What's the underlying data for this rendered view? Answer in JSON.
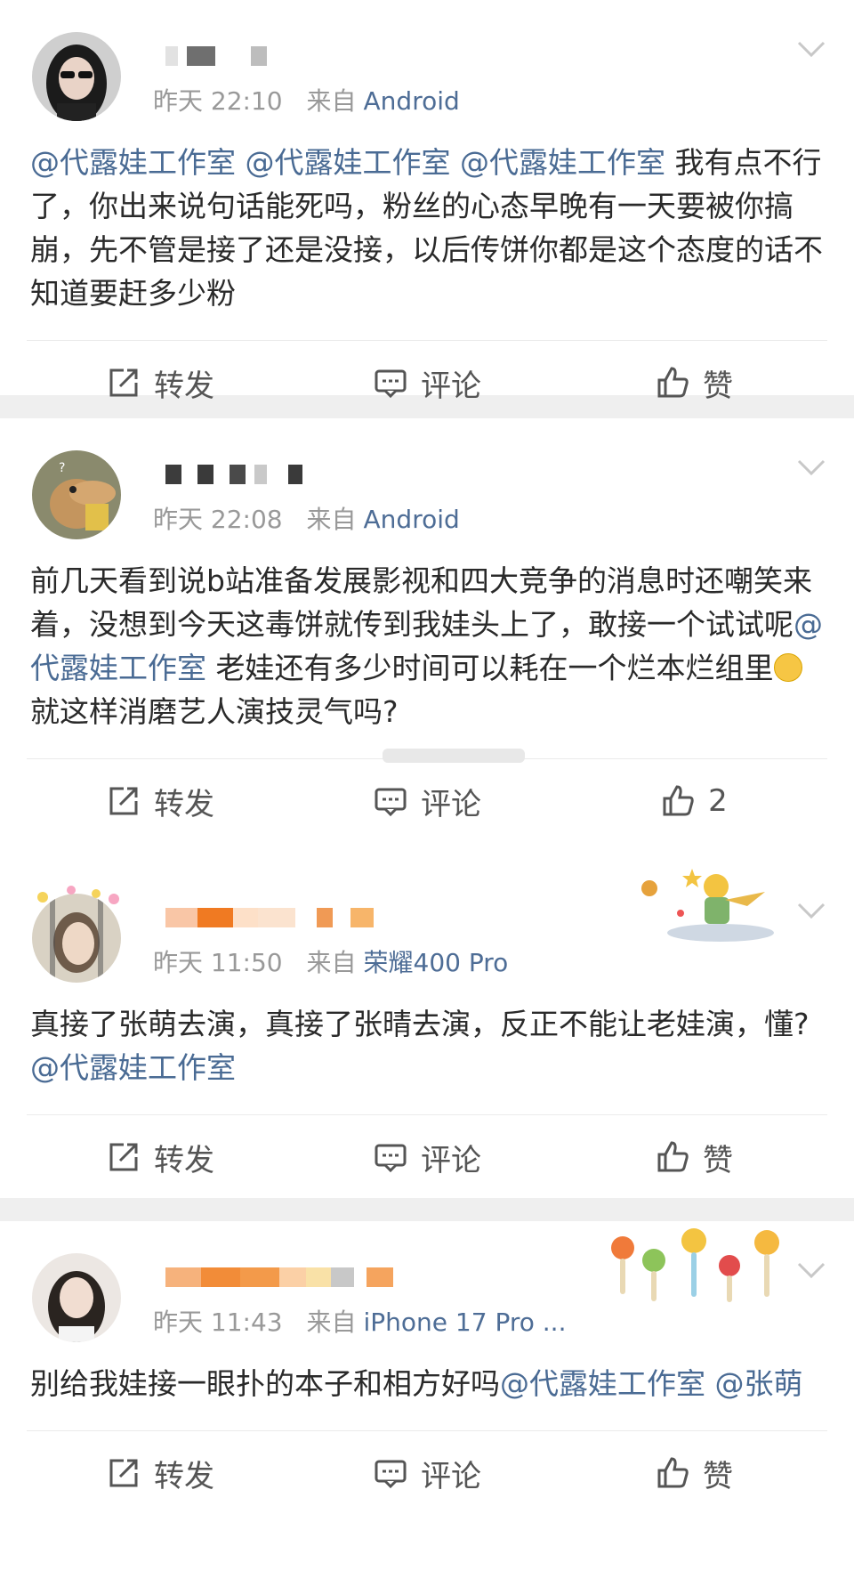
{
  "posts": [
    {
      "time": "昨天 22:10",
      "from": "来自",
      "source": "Android",
      "content": [
        {
          "t": "mention",
          "v": "@代露娃工作室"
        },
        {
          "t": "text",
          "v": " "
        },
        {
          "t": "mention",
          "v": "@代露娃工作室"
        },
        {
          "t": "text",
          "v": " "
        },
        {
          "t": "mention",
          "v": "@代露娃工作室"
        },
        {
          "t": "text",
          "v": " 我有点不行了，你出来说句话能死吗，粉丝的心态早晚有一天要被你搞崩，先不管是接了还是没接，以后传饼你都是这个态度的话不知道要赶多少粉"
        }
      ],
      "actions": {
        "repost": "转发",
        "comment": "评论",
        "like": "赞"
      }
    },
    {
      "time": "昨天 22:08",
      "from": "来自",
      "source": "Android",
      "content": [
        {
          "t": "text",
          "v": "前几天看到说b站准备发展影视和四大竞争的消息时还嘲笑来着，没想到今天这毒饼就传到我娃头上了，敢接一个试试呢"
        },
        {
          "t": "mention",
          "v": "@代露娃工作室"
        },
        {
          "t": "text",
          "v": " 老娃还有多少时间可以耗在一个烂本烂组里"
        },
        {
          "t": "emoji",
          "v": "thinking-face"
        },
        {
          "t": "text",
          "v": "就这样消磨艺人演技灵气吗?"
        }
      ],
      "actions": {
        "repost": "转发",
        "comment": "评论",
        "like": "2"
      }
    },
    {
      "time": "昨天 11:50",
      "from": "来自",
      "source": "荣耀400 Pro",
      "content": [
        {
          "t": "text",
          "v": "真接了张萌去演，真接了张晴去演，反正不能让老娃演，懂?"
        },
        {
          "t": "mention",
          "v": "@代露娃工作室"
        }
      ],
      "actions": {
        "repost": "转发",
        "comment": "评论",
        "like": "赞"
      }
    },
    {
      "time": "昨天 11:43",
      "from": "来自",
      "source": "iPhone 17 Pro ...",
      "content": [
        {
          "t": "text",
          "v": "别给我娃接一眼扑的本子和相方好吗"
        },
        {
          "t": "mention",
          "v": "@代露娃工作室"
        },
        {
          "t": "text",
          "v": " "
        },
        {
          "t": "mention",
          "v": "@张萌"
        }
      ],
      "actions": {
        "repost": "转发",
        "comment": "评论",
        "like": "赞"
      }
    }
  ],
  "colors": {
    "mention": "#4a6b94",
    "meta": "#999999",
    "source": "#4e6d96",
    "separator": "#efefef"
  }
}
